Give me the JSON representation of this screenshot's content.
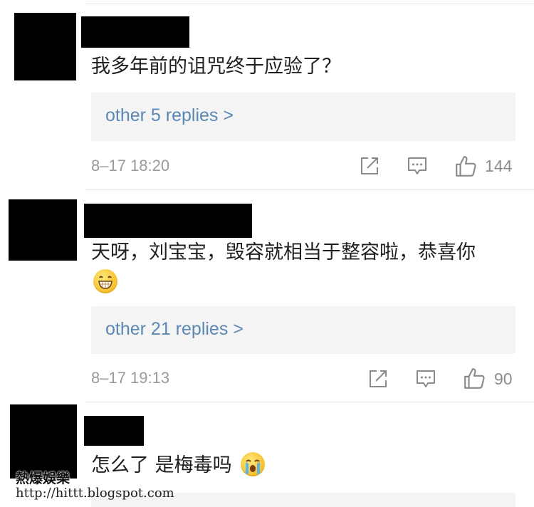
{
  "comments": [
    {
      "text": "我多年前的诅咒终于应验了？",
      "replies_label": "other 5 replies >",
      "time": "8–17 18:20",
      "likes": "144"
    },
    {
      "text": "天呀，刘宝宝，毁容就相当于整容啦，恭喜你",
      "emoji": "grinning-emoji",
      "replies_label": "other 21 replies >",
      "time": "8–17 19:13",
      "likes": "90"
    },
    {
      "text": "怎么了 是梅毒吗",
      "emoji": "crying-emoji"
    }
  ],
  "icons": [
    "share-icon",
    "comment-icon",
    "like-icon"
  ],
  "watermark": {
    "title": "熱爆娛樂",
    "url": "http://hittt.blogspot.com"
  }
}
